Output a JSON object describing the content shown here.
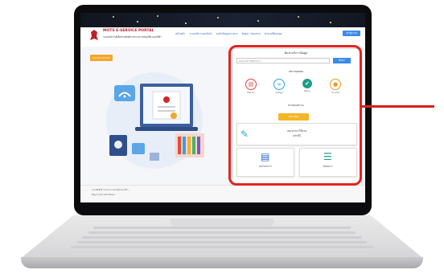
{
  "header": {
    "brand": "MOTS E-SERVICE PORTAL",
    "tagline": "ระบบบริการอิเล็กทรอนิกส์กระทรวงการท่องเที่ยวและกีฬา",
    "nav": [
      "หน้าหลัก",
      "ระบบบริการออนไลน์",
      "ขอรับข้อมูลข่าวสาร",
      "ติดต่อ / สอบถาม",
      "คำถามที่พบบ่อย"
    ],
    "login_label": "เข้าสู่ระบบ"
  },
  "sidebar": {
    "contact_label": "Contact Portal"
  },
  "panel": {
    "title": "ค้นหาบริการข้อมูล",
    "search_placeholder": "ค้นหาบริการที่ต้องการ...",
    "search_button": "ค้นหา",
    "section_services": "บริการยอดนิยม",
    "services": [
      {
        "label": "ยื่นคำขอ",
        "icon": "document-icon",
        "color": "#e0473a"
      },
      {
        "label": "ขอข้อมูล",
        "icon": "wifi-icon",
        "color": "#2aa7e0"
      },
      {
        "label": "ติดตาม",
        "icon": "tracking-icon",
        "color": "#1f9d8a"
      },
      {
        "label": "ชำระเงิน",
        "icon": "payment-icon",
        "color": "#f29a1e"
      }
    ],
    "section_checkstatus": "ตรวจสอบสถานะ",
    "check_button": "ตรวจสอบ",
    "card1_title": "แนะนำการใช้งาน",
    "card1_sub": "คลิกที่นี่",
    "card2_label": "ขอรับบริการ",
    "card3_label": "ติดต่อเรา"
  },
  "footer": {
    "line1": "สงวนลิขสิทธิ์ กระทรวงการท่องเที่ยวและกีฬา",
    "line2": "ที่อยู่: 4 ถนนราชดำเนินนอก"
  },
  "colors": {
    "highlight": "#e3241e",
    "accent": "#3b8beb",
    "orange": "#f3a52d"
  }
}
